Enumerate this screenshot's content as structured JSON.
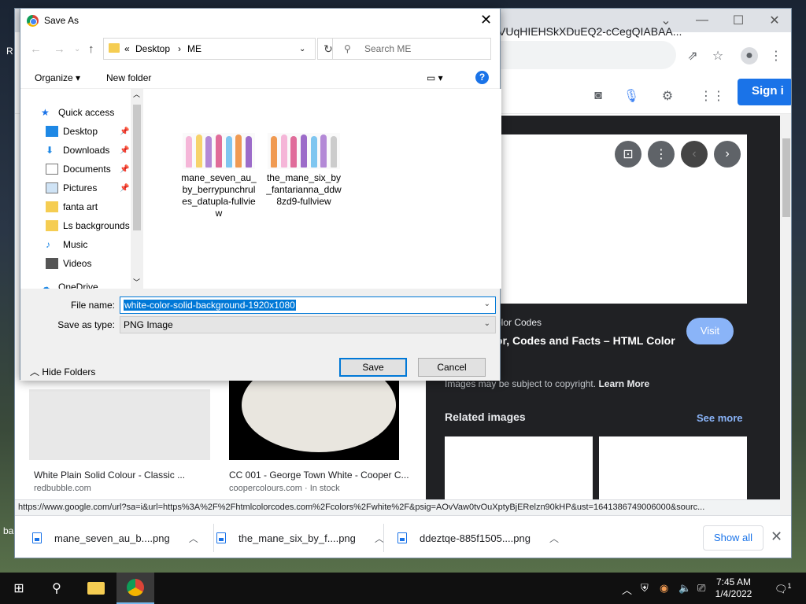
{
  "desktop": {
    "frag_r": "R",
    "frag_ba": "ba"
  },
  "chrome": {
    "omnibox_text": "VUqHIEHSkXDuEQ2-cCegQIABAA...",
    "signin_label": "Sign i",
    "preview": {
      "source": "olor Codes",
      "title": "or, Codes and Facts – HTML Color",
      "visit_label": "Visit",
      "copyright_text": "Images may be subject to copyright.",
      "learn_more": "Learn More",
      "related_label": "Related images",
      "see_more_label": "See more"
    },
    "cards": [
      {
        "title": "White Plain Solid Colour - Classic ...",
        "source": "redbubble.com"
      },
      {
        "title": "CC 001 - George Town White - Cooper C...",
        "source": "coopercolours.com · In stock"
      }
    ],
    "status_url": "https://www.google.com/url?sa=i&url=https%3A%2F%2Fhtmlcolorcodes.com%2Fcolors%2Fwhite%2F&psig=AOvVaw0tvOuXptyBjERelzn90kHP&ust=1641386749006000&sourc...",
    "downloads": [
      {
        "name": "mane_seven_au_b....png"
      },
      {
        "name": "the_mane_six_by_f....png"
      },
      {
        "name": "ddeztqe-885f1505....png"
      }
    ],
    "show_all_label": "Show all"
  },
  "dialog": {
    "title": "Save As",
    "breadcrumb": {
      "prefix": "«",
      "part1": "Desktop",
      "sep": "›",
      "part2": "ME"
    },
    "search_placeholder": "Search ME",
    "organize_label": "Organize",
    "new_folder_label": "New folder",
    "nav_items": [
      {
        "label": "Quick access"
      },
      {
        "label": "Desktop"
      },
      {
        "label": "Downloads"
      },
      {
        "label": "Documents"
      },
      {
        "label": "Pictures"
      },
      {
        "label": "fanta art"
      },
      {
        "label": "Ls backgrounds"
      },
      {
        "label": "Music"
      },
      {
        "label": "Videos"
      },
      {
        "label": "OneDrive"
      }
    ],
    "files": [
      {
        "name": "mane_seven_au_by_berrypunchrules_datupla-fullview"
      },
      {
        "name": "the_mane_six_by_fantarianna_ddw8zd9-fullview"
      }
    ],
    "filename_label": "File name:",
    "filename_value": "white-color-solid-background-1920x1080",
    "savetype_label": "Save as type:",
    "savetype_value": "PNG Image",
    "hide_folders_label": "Hide Folders",
    "save_label": "Save",
    "cancel_label": "Cancel"
  },
  "taskbar": {
    "time": "7:45 AM",
    "date": "1/4/2022",
    "notification_count": "1"
  }
}
